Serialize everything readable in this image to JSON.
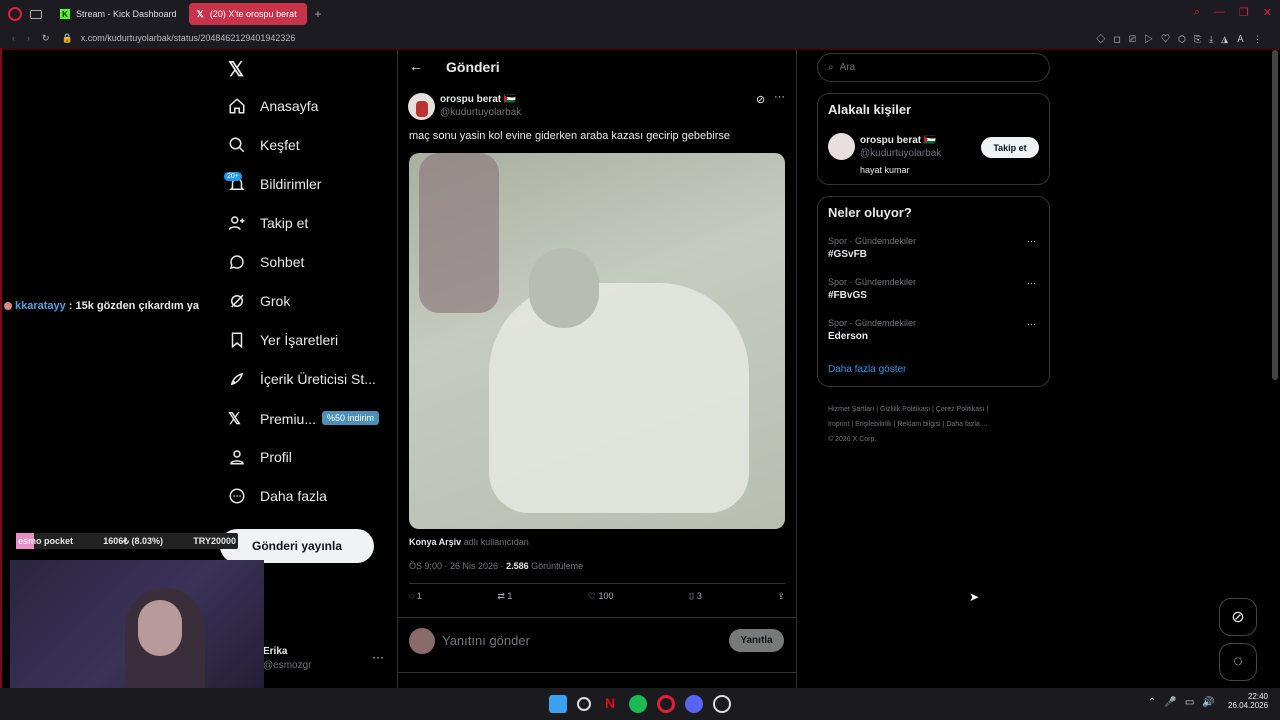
{
  "browser": {
    "tabs": [
      {
        "label": "Stream - Kick Dashboard"
      },
      {
        "label": "(20) X'te orospu berat"
      }
    ],
    "url": "x.com/kudurtuyolarbak/status/2048462129401942326"
  },
  "nav": {
    "items": [
      {
        "label": "Anasayfa"
      },
      {
        "label": "Keşfet"
      },
      {
        "label": "Bildirimler"
      },
      {
        "label": "Takip et"
      },
      {
        "label": "Sohbet"
      },
      {
        "label": "Grok"
      },
      {
        "label": "Yer İşaretleri"
      },
      {
        "label": "İçerik Üreticisi St..."
      },
      {
        "label": "Premiu..."
      },
      {
        "label": "Profil"
      },
      {
        "label": "Daha fazla"
      }
    ],
    "notif_badge": "20+",
    "premium_badge": "%50 indirim",
    "post_button": "Gönderi yayınla",
    "account_name": "Erika",
    "account_handle": "@esmozgr"
  },
  "post": {
    "header": "Gönderi",
    "author": "orospu berat 🇵🇸",
    "handle": "@kudurtuyolarbak",
    "text": "maç sonu yasin kol evine giderken araba kazası gecirip gebebirse",
    "source_user": "Konya Arşiv",
    "source_suffix": "adlı kullanıcıdan",
    "time": "ÖS 9:00 · 26 Nis 2026 ·",
    "views": "2.586",
    "views_label": "Görüntüleme",
    "replies": "1",
    "reposts": "1",
    "likes": "100",
    "bookmarks": "3",
    "reply_placeholder": "Yanıtını gönder",
    "reply_button": "Yanıtla"
  },
  "sidebar": {
    "search_placeholder": "Ara",
    "related_title": "Alakalı kişiler",
    "related_name": "orospu berat 🇵🇸",
    "related_handle": "@kudurtuyolarbak",
    "related_bio": "hayat kumar",
    "follow_label": "Takip et",
    "trends_title": "Neler oluyor?",
    "trends": [
      {
        "context": "Spor · Gündemdekiler",
        "name": "#GSvFB"
      },
      {
        "context": "Spor · Gündemdekiler",
        "name": "#FBvGS"
      },
      {
        "context": "Spor · Gündemdekiler",
        "name": "Ederson"
      }
    ],
    "show_more": "Daha fazla göster",
    "footer1": [
      "Hizmet Şartları",
      "Gizlilik Politikası",
      "Çerez Politikası"
    ],
    "footer2": [
      "Imprint",
      "Erişilebilirlik",
      "Reklam bilgisi",
      "Daha fazla ..."
    ],
    "copyright": "© 2026 X Corp."
  },
  "overlay": {
    "chat_user": "kkaratayy",
    "chat_msg": ": 15k gözden çıkardım ya",
    "pocket_label": "esmo pocket",
    "pocket_value": "1606₺ (8.03%)",
    "pocket_target": "TRY20000"
  },
  "system": {
    "time": "22:40",
    "date": "26.04.2026"
  },
  "colors": {
    "accent": "#1d9bf0",
    "brand": "#c8334a"
  }
}
